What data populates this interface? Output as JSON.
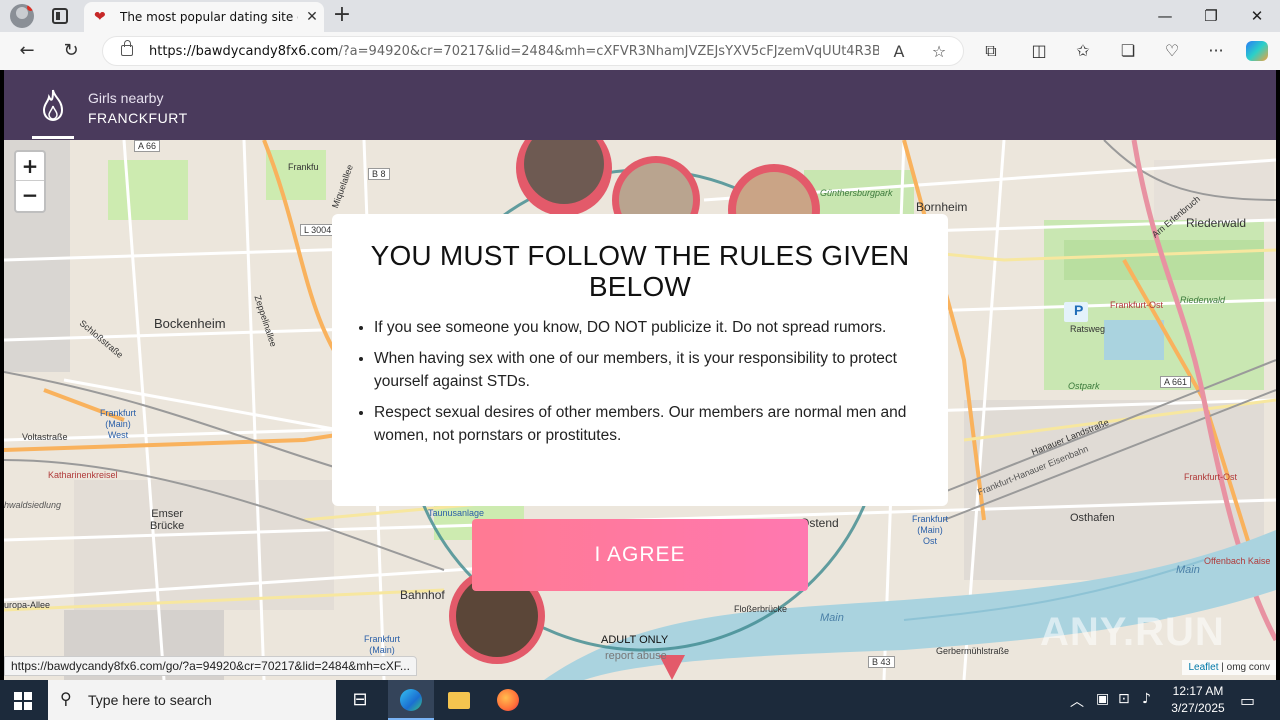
{
  "browser": {
    "tab_title": "The most popular dating site of t",
    "url_host": "https://bawdycandy8fx6.com",
    "url_rest": "/?a=94920&cr=70217&lid=2484&mh=cXFVR3NhamJVZEJsYXV5cFJzemVqUUt4R3BsQ...",
    "status_url": "https://bawdycandy8fx6.com/go/?a=94920&cr=70217&lid=2484&mh=cXF..."
  },
  "header": {
    "line1": "Girls nearby",
    "line2": "FRANCKFURT"
  },
  "map": {
    "zoom_in": "+",
    "zoom_out": "−",
    "labels": {
      "bockenheim": "Bockenheim",
      "bornheim": "Bornheim",
      "riederwald": "Riederwald",
      "riederwald2": "Riederwald",
      "ostpark": "Ostpark",
      "frankfurt_ost": "Frankfurt-Ost",
      "frankfurt_ost2": "Frankfurt-Ost",
      "frankfurt_west": "Frankfurt\n(Main)\nWest",
      "frankfurt_main_ost": "Frankfurt\n(Main)\nOst",
      "osthafen": "Osthafen",
      "ostend": "Ostend",
      "emser_brucke": "Emser\nBrücke",
      "bahnhof": "Bahnhof",
      "frankfurt_main": "Frankfurt\n(Main)",
      "katharinenkreisel": "Katharinenkreisel",
      "voltastrasse": "Voltastraße",
      "taunusanlage": "Taunusanlage",
      "flosserbrucke": "Floßerbrücke",
      "main": "Main",
      "gunthersburgpark": "Günthersburgpark",
      "ratsweg": "Ratsweg",
      "gerbermuhlstrasse": "Gerbermühlstraße",
      "offenbach": "Offenbach Kaise",
      "europa_allee": "uropa-Allee",
      "b8": "B 8",
      "b43": "B 43",
      "a661": "A 661",
      "l3004": "L 3004",
      "a66": "A 66",
      "frankfu": "Frankfu",
      "zeppelinallee": "Zeppelinallee",
      "miquelallee": "Miquelallee",
      "schlossstrasse": "Schloßstraße",
      "hanauer": "Hanauer Landstraße",
      "hanauer_eisenbahn": "Frankfurt-Hanauer Eisenbahn",
      "am_erlenbruch": "Am Erlenbruch",
      "riederwal": "Riederwal",
      "wald_siedlung": "hwaldsiedlung",
      "ostbahnhof_main": "Main",
      "parking": "P"
    },
    "attribution_link": "Leaflet",
    "attribution_rest": " | omg conv",
    "watermark": "ANY.RUN"
  },
  "modal": {
    "title": "YOU MUST FOLLOW THE RULES GIVEN BELOW",
    "rules": [
      "If you see someone you know, DO NOT publicize it. Do not spread rumors.",
      "When having sex with one of our members, it is your responsibility to protect yourself against STDs.",
      "Respect sexual desires of other members. Our members are normal men and women, not pornstars or prostitutes."
    ],
    "agree_label": "I AGREE"
  },
  "footer": {
    "adult_only": "ADULT ONLY",
    "report_abuse": "report abuse"
  },
  "taskbar": {
    "search_placeholder": "Type here to search",
    "time": "12:17 AM",
    "date": "3/27/2025"
  },
  "colors": {
    "header_bg": "#4a3a5c",
    "agree_gradient_start": "#ff7a93",
    "agree_gradient_end": "#ff78b0",
    "taskbar_bg": "#1c2a3b"
  },
  "icons": [
    "profile-icon",
    "tab-actions-icon",
    "heart-favicon-icon",
    "close-tab-icon",
    "new-tab-icon",
    "minimize-icon",
    "restore-icon",
    "close-window-icon",
    "back-icon",
    "refresh-icon",
    "lock-icon",
    "read-aloud-icon",
    "favorite-star-icon",
    "extensions-icon",
    "split-screen-icon",
    "favorites-icon",
    "collections-icon",
    "performance-icon",
    "more-icon",
    "copilot-icon",
    "flame-icon",
    "windows-start-icon",
    "search-icon",
    "task-view-icon",
    "edge-icon",
    "file-explorer-icon",
    "firefox-icon",
    "chevron-up-icon",
    "network-icon",
    "volume-icon",
    "notification-icon"
  ]
}
